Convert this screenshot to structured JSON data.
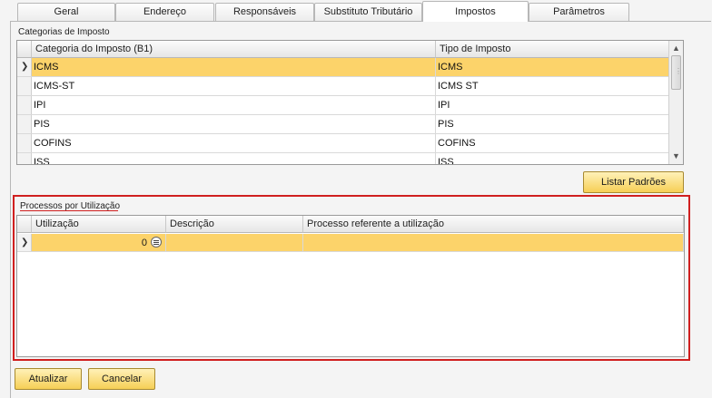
{
  "tabs": [
    "Geral",
    "Endereço",
    "Responsáveis",
    "Substituto Tributário",
    "Impostos",
    "Parâmetros"
  ],
  "active_tab": "Impostos",
  "categorias": {
    "title": "Categorias de Imposto",
    "columns": [
      "Categoria do Imposto (B1)",
      "Tipo de Imposto"
    ],
    "rows": [
      [
        "ICMS",
        "ICMS"
      ],
      [
        "ICMS-ST",
        "ICMS ST"
      ],
      [
        "IPI",
        "IPI"
      ],
      [
        "PIS",
        "PIS"
      ],
      [
        "COFINS",
        "COFINS"
      ],
      [
        "ISS",
        "ISS"
      ]
    ],
    "selected_row": 0
  },
  "listar_padroes_label": "Listar Padrões",
  "processos": {
    "title": "Processos por Utilização",
    "columns": [
      "Utilização",
      "Descrição",
      "Processo referente a utilização"
    ],
    "row": {
      "utilizacao": "0",
      "descricao": "",
      "processo": ""
    }
  },
  "footer": {
    "atualizar_label": "Atualizar",
    "cancelar_label": "Cancelar"
  },
  "colors": {
    "selection": "#fcd36a",
    "highlight_border": "#d01f1f",
    "button": "#f6cf56"
  }
}
